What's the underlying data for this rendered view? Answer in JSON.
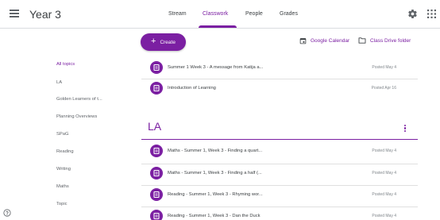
{
  "header": {
    "class_title": "Year 3",
    "tabs": [
      {
        "label": "Stream",
        "active": false
      },
      {
        "label": "Classwork",
        "active": true
      },
      {
        "label": "People",
        "active": false
      },
      {
        "label": "Grades",
        "active": false
      }
    ]
  },
  "sidebar": {
    "items": [
      {
        "label": "All topics",
        "selected": true
      },
      {
        "label": "LA",
        "selected": false
      },
      {
        "label": "Golden Learners of t...",
        "selected": false
      },
      {
        "label": "Planning Overviews",
        "selected": false
      },
      {
        "label": "SPaG",
        "selected": false
      },
      {
        "label": "Reading",
        "selected": false
      },
      {
        "label": "Writing",
        "selected": false
      },
      {
        "label": "Maths",
        "selected": false
      },
      {
        "label": "Topic",
        "selected": false
      }
    ]
  },
  "toolbar": {
    "create_label": "Create",
    "google_calendar_label": "Google Calendar",
    "class_drive_folder_label": "Class Drive folder"
  },
  "ungrouped_items": [
    {
      "title": "Summer 1 Week 3 - A message from Katija a...",
      "posted": "Posted May 4"
    },
    {
      "title": "Introduction of Learning",
      "posted": "Posted Apr 16"
    }
  ],
  "topic": {
    "name": "LA",
    "items": [
      {
        "title": "Maths - Summer 1, Week 3 - Finding a quart...",
        "posted": "Posted May 4"
      },
      {
        "title": "Maths - Summer 1, Week 3 - Finding a half (...",
        "posted": "Posted May 4"
      },
      {
        "title": "Reading - Summer 1, Week 3 - Rhyming wor...",
        "posted": "Posted May 4"
      },
      {
        "title": "Reading - Summer 1, Week 3 - Dan the Duck",
        "posted": "Posted May 4"
      }
    ]
  },
  "colors": {
    "accent": "#7b1fa2",
    "text": "#3c4043",
    "muted": "#80868b",
    "divider": "#e0e0e0"
  },
  "icons": {
    "menu": "hamburger-icon",
    "settings": "gear-icon",
    "apps": "apps-grid-icon",
    "help": "help-icon",
    "calendar": "calendar-icon",
    "folder": "folder-icon",
    "assignment": "assignment-icon",
    "more": "more-vertical-icon"
  }
}
